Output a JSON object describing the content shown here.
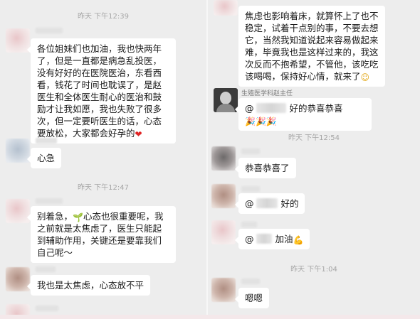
{
  "left": {
    "time1": "昨天 下午12:39",
    "msg1": "各位姐妹们也加油，我也快两年了，但是一直都是病急乱投医，没有好好的在医院医治，东看西看，钱花了时间也耽误了，是赵医生和全体医生耐心的医治和鼓励才让我如愿，我也失败了很多次，但一定要听医生的话，心态要放松，大家都会好孕的",
    "msg1_emoji": "❤",
    "msg2": "心急",
    "time2": "昨天 下午12:47",
    "msg3_a": "别着急，",
    "msg3_emoji": "🌱",
    "msg3_b": "心态也很重要呢，我之前就是太焦虑了，医生只能起到辅助作用，关键还是要靠我们自己呢～",
    "msg4": "我也是太焦虑，心态放不平"
  },
  "right": {
    "msg1": "焦虑也影响着床，就算怀上了也不稳定，试着干点别的事，不要去想它，当然我知道说起来容易做起来难，毕竟我也是这样过来的，我这次反而不抱希望，不管他，该吃吃该喝喝，保持好心情，就来了",
    "msg1_emoji": "☺",
    "doctor_name": "生殖医学科赵主任",
    "msg2_prefix": "@",
    "msg2_suffix": "好的恭喜恭喜",
    "msg2_emoji": "🎉🎉🎉",
    "time1": "昨天 下午12:54",
    "msg3": "恭喜恭喜了",
    "msg4_prefix": "@",
    "msg4_suffix": "好的",
    "msg5_prefix": "@",
    "msg5_suffix": "加油",
    "msg5_emoji": "💪",
    "time2": "昨天 下午1:04",
    "msg6": "嗯嗯"
  },
  "colors": {
    "background": "#ededed",
    "bubble": "#ffffff",
    "timestamp": "#a6a6a6"
  }
}
